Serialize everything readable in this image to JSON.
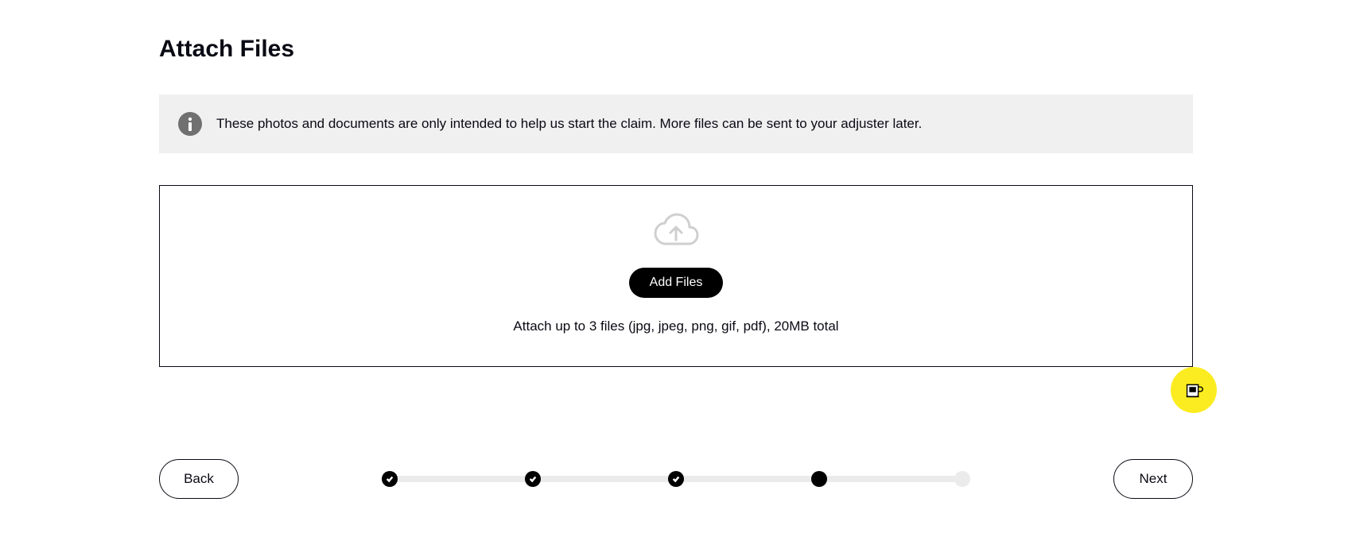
{
  "header": {
    "title": "Attach Files"
  },
  "banner": {
    "text": "These photos and documents are only intended to help us start the claim. More files can be sent to your adjuster later."
  },
  "upload": {
    "button_label": "Add Files",
    "hint": "Attach up to 3 files (jpg, jpeg, png, gif, pdf), 20MB total"
  },
  "nav": {
    "back_label": "Back",
    "next_label": "Next"
  },
  "progress": {
    "steps": [
      {
        "state": "complete"
      },
      {
        "state": "complete"
      },
      {
        "state": "complete"
      },
      {
        "state": "current"
      },
      {
        "state": "pending"
      }
    ]
  }
}
